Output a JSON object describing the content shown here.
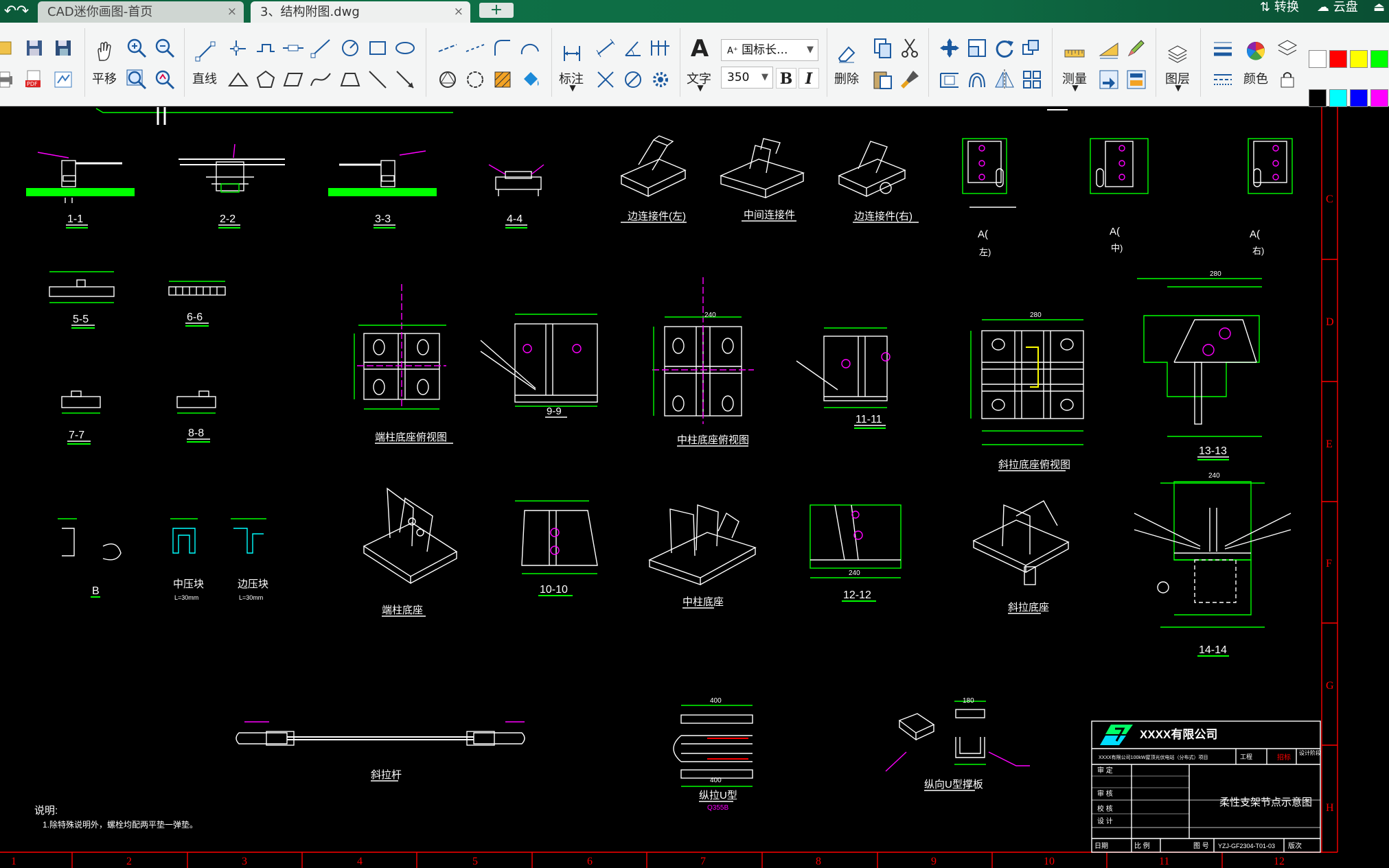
{
  "titlebar": {
    "undo_icon": "undo-icon",
    "redo_icon": "redo-icon",
    "tabs": [
      {
        "label": "CAD迷你画图-首页",
        "close": "×"
      },
      {
        "label": "3、结构附图.dwg",
        "close": "×"
      }
    ],
    "add_tab": "+",
    "convert_label": "转换",
    "cloud_label": "云盘"
  },
  "ribbon": {
    "pan_label": "平移",
    "line_label": "直线",
    "dimension_label": "标注",
    "text_label": "文字",
    "text_style": "国标长...",
    "text_height": "350",
    "bold_label": "B",
    "italic_label": "I",
    "delete_label": "删除",
    "measure_label": "测量",
    "layer_label": "图层",
    "color_label": "颜色",
    "swatches": [
      "#ffffff",
      "#ff0000",
      "#ffff00",
      "#00ff00",
      "#000000",
      "#00ffff",
      "#0000ff",
      "#ff00ff"
    ]
  },
  "drawing": {
    "border_letters": [
      "C",
      "D",
      "E",
      "F",
      "G",
      "H"
    ],
    "border_numbers": [
      "1",
      "2",
      "3",
      "4",
      "5",
      "6",
      "7",
      "8",
      "9",
      "10",
      "11",
      "12"
    ],
    "labels": {
      "s1": "1-1",
      "s2": "2-2",
      "s3": "3-3",
      "s4": "4-4",
      "left_conn": "边连接件(左)",
      "mid_conn": "中间连接件",
      "right_conn": "边连接件(右)",
      "a_left": "A(",
      "a_left2": "左)",
      "a_mid": "A(",
      "a_mid2": "中)",
      "a_right": "A(",
      "a_right2": "右)",
      "s5": "5-5",
      "s6": "6-6",
      "s7": "7-7",
      "s8": "8-8",
      "end_base_top": "端柱底座俯视图",
      "s9": "9-9",
      "mid_base_top": "中柱底座俯视图",
      "s11": "11-11",
      "brace_base_top": "斜拉底座俯视图",
      "s13": "13-13",
      "b": "B",
      "mid_press": "中压块",
      "mid_press_sub": "L=30mm",
      "edge_press": "边压块",
      "edge_press_sub": "L=30mm",
      "end_base": "端柱底座",
      "s10": "10-10",
      "mid_base": "中柱底座",
      "s12": "12-12",
      "brace_base": "斜拉底座",
      "s14": "14-14",
      "brace_rod": "斜拉杆",
      "u_type": "纵拉U型",
      "u_type_sub": "Q355B",
      "u_plate": "纵向U型撑板",
      "notes_title": "说明:",
      "notes_line": "1.除特殊说明外，螺栓均配两平垫一弹垫。",
      "company": "XXXX有限公司",
      "project_line": "XXXX有限公司100kW屋顶光伏电站（分布式）项目",
      "title_engineering": "工程",
      "title_stage_label": "设计阶段",
      "title_stage_value": "招标",
      "drawing_title": "柔性支架节点示意图",
      "tb_review": "审 定",
      "tb_check": "审 核",
      "tb_proof": "校 核",
      "tb_design": "设 计",
      "tb_date": "日期",
      "tb_scale": "比 例",
      "tb_drawing_no_label": "图 号",
      "tb_drawing_no": "YZJ-GF2304-T01-03",
      "tb_version": "版次",
      "dim_280": "280",
      "dim_240": "240",
      "dim_400": "400",
      "dim_180": "180"
    }
  }
}
